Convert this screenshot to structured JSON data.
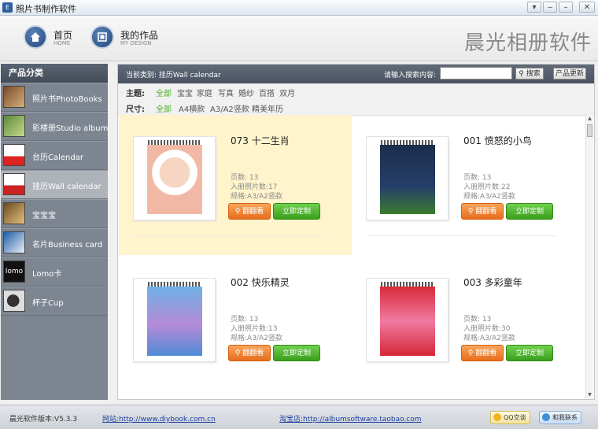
{
  "window": {
    "title": "照片书制作软件",
    "icon_label": "E"
  },
  "nav": {
    "home_label": "首页",
    "home_sub": "HOME",
    "design_label": "我的作品",
    "design_sub": "MY DESIGN",
    "brand": "晨光相册软件"
  },
  "sidebar": {
    "header": "产品分类",
    "items": [
      {
        "label": "照片书PhotoBooks",
        "icon": "photobook-thumb"
      },
      {
        "label": "影楼册Studio album",
        "icon": "studio-album-thumb"
      },
      {
        "label": "台历Calendar",
        "icon": "desk-calendar-thumb"
      },
      {
        "label": "挂历Wall calendar",
        "icon": "wall-calendar-thumb"
      },
      {
        "label": "宝宝宝",
        "icon": "baby-book-thumb"
      },
      {
        "label": "名片Business card",
        "icon": "business-card-thumb"
      },
      {
        "label": "Lomo卡",
        "icon": "lomo-card-thumb"
      },
      {
        "label": "杯子Cup",
        "icon": "cup-thumb"
      }
    ],
    "active_index": 3
  },
  "category_bar": {
    "current": "当前类别: 挂历Wall calendar",
    "search_label": "请输入搜索内容:",
    "search_value": "",
    "search_button": "搜索",
    "update_button": "产品更新"
  },
  "filters": {
    "theme": {
      "label": "主题:",
      "options": [
        "全部",
        "宝宝",
        "家庭",
        "写真",
        "婚纱",
        "百搭",
        "双月"
      ],
      "selected": 0
    },
    "size": {
      "label": "尺寸:",
      "options": [
        "全部",
        "A4横款",
        "A3/A2竖款",
        "精美年历"
      ],
      "selected": 0
    }
  },
  "products": [
    {
      "title": "073 十二生肖",
      "pages": "页数:  13",
      "photos": "入册照片数:17",
      "spec": "规格:A3/A2竖款",
      "flip": "翻翻看",
      "order": "立即定制"
    },
    {
      "title": "001 愤怒的小鸟",
      "pages": "页数:  13",
      "photos": "入册照片数:22",
      "spec": "规格:A3/A2竖款",
      "flip": "翻翻看",
      "order": "立即定制"
    },
    {
      "title": "002 快乐精灵",
      "pages": "页数:  13",
      "photos": "入册照片数:13",
      "spec": "规格:A3/A2竖款",
      "flip": "翻翻看",
      "order": "立即定制"
    },
    {
      "title": "003 多彩童年",
      "pages": "页数:  13",
      "photos": "入册照片数:30",
      "spec": "规格:A3/A2竖款",
      "flip": "翻翻看",
      "order": "立即定制"
    }
  ],
  "status": {
    "version": "晨光软件版本:V5.3.3",
    "website": "网站:http://www.diybook.com.cn",
    "shop": "淘宝店:http://albumsoftware.taobao.com",
    "qq": "QQ交谈",
    "contact": "和我联系"
  },
  "colors": {
    "accent_green": "#4caf20",
    "flip_orange": "#e86d1c",
    "order_green": "#3a9e1d",
    "highlight": "#fff4cc",
    "sidebar": "#7d8591"
  }
}
